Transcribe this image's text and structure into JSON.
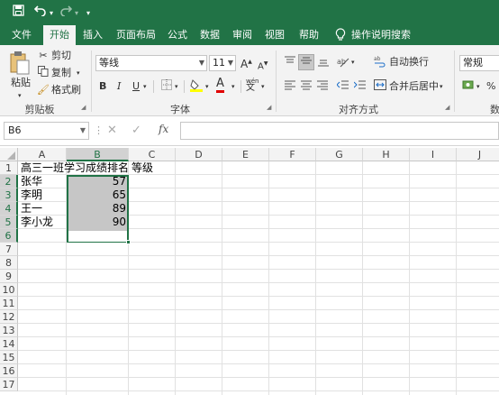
{
  "titlebar": {
    "save_icon": "save-icon",
    "undo_icon": "undo-icon",
    "redo_icon": "redo-icon",
    "customize_icon": "customize-qat-icon",
    "accent": "#217346"
  },
  "tabs": [
    {
      "label": "文件"
    },
    {
      "label": "开始"
    },
    {
      "label": "插入"
    },
    {
      "label": "页面布局"
    },
    {
      "label": "公式"
    },
    {
      "label": "数据"
    },
    {
      "label": "审阅"
    },
    {
      "label": "视图"
    },
    {
      "label": "帮助"
    }
  ],
  "tellme": {
    "label": "操作说明搜索",
    "icon": "lightbulb-icon"
  },
  "ribbon": {
    "clipboard": {
      "paste": "粘贴",
      "cut": "剪切",
      "copy": "复制",
      "format_painter": "格式刷",
      "group_label": "剪贴板"
    },
    "font": {
      "font_name": "等线",
      "font_size": "11",
      "grow": "A",
      "shrink": "A",
      "bold": "B",
      "italic": "I",
      "underline": "U",
      "font_color_letter": "A",
      "phonetic": "wén",
      "group_label": "字体"
    },
    "alignment": {
      "wrap_text": "自动换行",
      "merge_center": "合并后居中",
      "group_label": "对齐方式"
    },
    "number": {
      "format": "常规",
      "percent": "%",
      "group_label_partial": "数"
    }
  },
  "formula_bar": {
    "name_box": "B6",
    "fx": "fx",
    "content": ""
  },
  "grid": {
    "columns": [
      "A",
      "B",
      "C",
      "D",
      "E",
      "F",
      "G",
      "H",
      "I",
      "J"
    ],
    "selected_column": "B",
    "rows": [
      "1",
      "2",
      "3",
      "4",
      "5",
      "6",
      "7",
      "8",
      "9",
      "10",
      "11",
      "12",
      "13",
      "14",
      "15",
      "16",
      "17"
    ],
    "selected_rows": [
      "2",
      "3",
      "4",
      "5",
      "6"
    ],
    "cells": {
      "A1": "高三一班学习成绩排名",
      "C1": "等级",
      "A2": "张华",
      "B2": "57",
      "A3": "李明",
      "B3": "65",
      "A4": "王一",
      "B4": "89",
      "A5": "李小龙",
      "B5": "90"
    }
  }
}
